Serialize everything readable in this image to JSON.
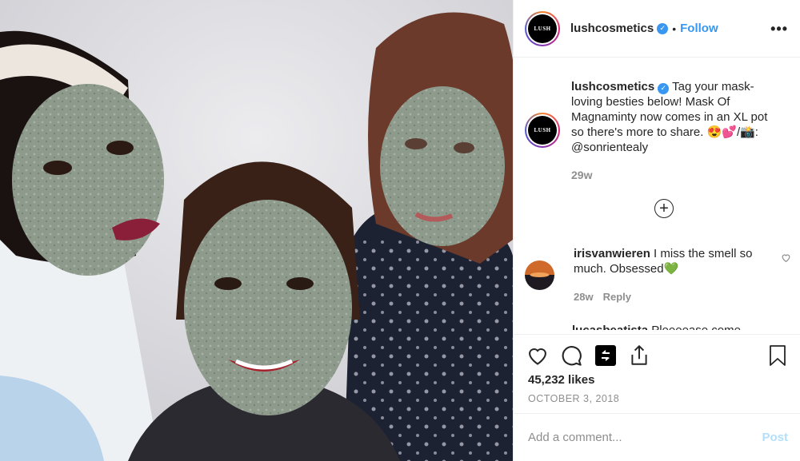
{
  "post": {
    "username": "lushcosmetics",
    "follow_label": "Follow",
    "separator": "•",
    "more_icon": "ellipsis-icon",
    "avatar_text": "LUSH"
  },
  "caption": {
    "username": "lushcosmetics",
    "text": " Tag your mask-loving besties below! Mask Of Magnaminty now comes in an XL pot so there's more to share. 😍💕/📸: @sonrientealy",
    "time": "29w"
  },
  "comments": [
    {
      "username": "irisvanwieren",
      "text": " I miss the smell so much. Obsessed💚",
      "time": "28w",
      "reply_label": "Reply"
    },
    {
      "username": "lucasbeatista",
      "text": "Pleeeease come"
    }
  ],
  "stats": {
    "likes": "45,232 likes",
    "date": "OCTOBER 3, 2018"
  },
  "add_comment": {
    "placeholder": "Add a comment...",
    "post_label": "Post"
  },
  "colors": {
    "accent": "#3897f0",
    "post_disabled": "#b2dffc",
    "muted": "#8e8e8e"
  }
}
